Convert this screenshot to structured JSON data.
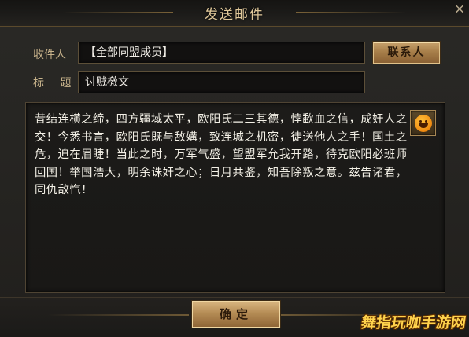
{
  "window": {
    "title": "发送邮件",
    "close_glyph": "×"
  },
  "form": {
    "recipient_label": "收件人",
    "recipient_value": "【全部同盟成员】",
    "contacts_button_label": "联系人",
    "subject_label": "标 题",
    "subject_value": "讨贼檄文",
    "body_text": "昔结连横之缔，四方疆域太平，欧阳氏二三其德，悖歃血之信，成奸人之交！今悉书言，欧阳氏既与敌媾，致连城之机密，徒送他人之手！国土之危，迫在眉睫！当此之时，万军气盛，望盟军允我开路，待克欧阳必班师回国！举国浩大，明余诛奸之心；日月共鉴，知吾除叛之意。兹告诸君，同仇敌忾！",
    "emoji_icon": "smiley-face-icon"
  },
  "footer": {
    "confirm_label": "确定"
  },
  "watermark": {
    "text": "舞指玩咖手游网"
  },
  "colors": {
    "accent_gold": "#e0c89a",
    "button_gold": "#b58c55",
    "panel_bg": "#262522"
  }
}
